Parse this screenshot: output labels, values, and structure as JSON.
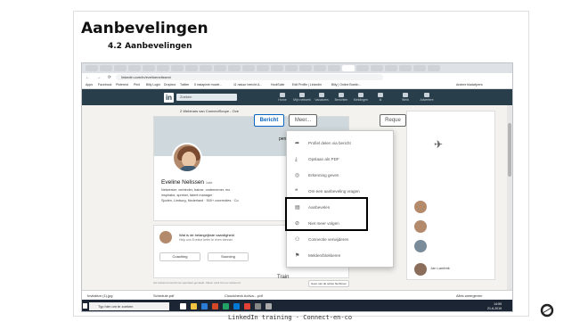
{
  "slide": {
    "title": "Aanbevelingen",
    "subtitle": "4.2 Aanbevelingen",
    "footer": "LinkedIn training - Connect-en-co"
  },
  "browser": {
    "url": "linkedin.com/in/evelinenelissen/",
    "bookmarks": [
      "Apps",
      "Facebook",
      "Pinterest",
      "Pinit",
      "Billy Login",
      "Dropbox",
      "Twitter",
      "5 instapinie model...",
      "11 natuur bericht.A...",
      "HootSuite",
      "Edit Profile | LinkedIn",
      "Billy | Online Boekh...",
      "Andere bladwijzers"
    ]
  },
  "linkedin": {
    "logo": "in",
    "search_placeholder": "Zoeken",
    "nav": [
      "Home",
      "Mijn netwerk",
      "Vacatures",
      "Berichten",
      "Meldingen",
      "Ik",
      "Werk",
      "Advertere"
    ]
  },
  "profile": {
    "webinar": "2 Webinars van ConnectScope - Ove",
    "name": "Eveline Nelissen",
    "degree": "1ste",
    "lines": [
      "Netwerker, verbinder, trainer, ondernemer, mo",
      "inspirator, spreker, talent manager",
      "Sjoden, Limburg, Nederland · 500+ connecties · Co"
    ],
    "university": "pen Universiteit",
    "btn_message": "Bericht",
    "btn_more": "Meer...",
    "btn_request": "Reque",
    "post_prompt": "Wat is de belangrijkste vaardigheid",
    "post_sub": "Help ons Eveline beter te leren kennen",
    "pills": [
      "Coaching",
      "Sourcing"
    ],
    "train_label": "Train",
    "footer_note": "Uw antwoord wordt niet openbaar gemaakt. Alleen uzelf ziet uw antwoord.",
    "skills_btn": "Geen van de opties hierboven",
    "contact_name": "Jan Lambrik",
    "messages_label": "Berichten"
  },
  "dropdown": {
    "items": [
      {
        "icon": "share-icon",
        "glyph": "➦",
        "label": "Profiel delen via bericht"
      },
      {
        "icon": "download-icon",
        "glyph": "⤓",
        "label": "Opslaan als PDF"
      },
      {
        "icon": "badge-icon",
        "glyph": "◎",
        "label": "Erkenning geven"
      },
      {
        "icon": "quote-icon",
        "glyph": "❝",
        "label": "Om een aanbeveling vragen"
      },
      {
        "icon": "recommend-icon",
        "glyph": "▤",
        "label": "Aanbevelen"
      },
      {
        "icon": "unfollow-icon",
        "glyph": "⊘",
        "label": "Niet meer volgen"
      },
      {
        "icon": "remove-connection-icon",
        "glyph": "⚇",
        "label": "Connectie verwijderen"
      },
      {
        "icon": "flag-icon",
        "glyph": "⚑",
        "label": "Melden/blokkeren"
      }
    ]
  },
  "downloads": {
    "items": [
      "Invitation (1).jpg",
      "Schedule.pdf",
      "Cloudcheck Activa....pdf"
    ],
    "show_all": "Alles weergeven"
  },
  "taskbar": {
    "search_placeholder": "Typ hier om te zoeken",
    "time": "14:59",
    "date": "21-6-2019"
  }
}
